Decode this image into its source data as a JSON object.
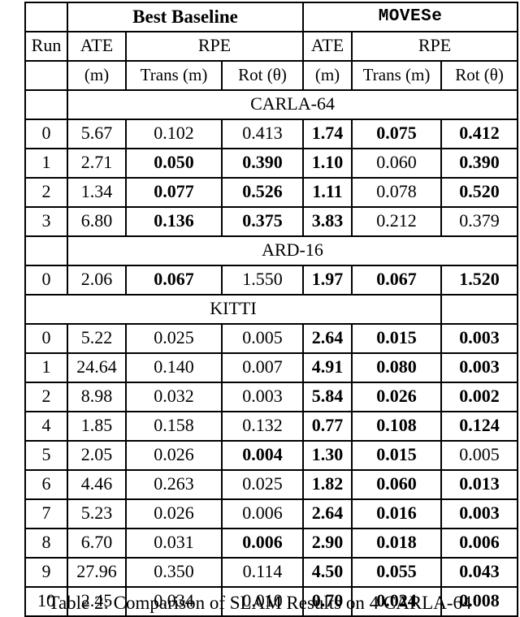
{
  "table": {
    "headers": {
      "group_blank": "",
      "group_baseline": "Best Baseline",
      "group_ours": "MOVESe",
      "run": "Run",
      "ate1": "ATE",
      "rpe1": "RPE",
      "ate2": "ATE",
      "rpe2": "RPE",
      "units_blank": "",
      "ate1_units": "(m)",
      "trans1": "Trans (m)",
      "rot1": "Rot (θ)",
      "ate2_units": "(m)",
      "trans2": "Trans (m)",
      "rot2": "Rot (θ)"
    },
    "sections": [
      {
        "name": "CARLA-64",
        "rows": [
          {
            "run": "0",
            "b_ate": "5.67",
            "b_ate_bold": false,
            "b_trans": "0.102",
            "b_trans_bold": false,
            "b_rot": "0.413",
            "b_rot_bold": false,
            "m_ate": "1.74",
            "m_ate_bold": true,
            "m_trans": "0.075",
            "m_trans_bold": true,
            "m_rot": "0.412",
            "m_rot_bold": true
          },
          {
            "run": "1",
            "b_ate": "2.71",
            "b_ate_bold": false,
            "b_trans": "0.050",
            "b_trans_bold": true,
            "b_rot": "0.390",
            "b_rot_bold": true,
            "m_ate": "1.10",
            "m_ate_bold": true,
            "m_trans": "0.060",
            "m_trans_bold": false,
            "m_rot": "0.390",
            "m_rot_bold": true
          },
          {
            "run": "2",
            "b_ate": "1.34",
            "b_ate_bold": false,
            "b_trans": "0.077",
            "b_trans_bold": true,
            "b_rot": "0.526",
            "b_rot_bold": true,
            "m_ate": "1.11",
            "m_ate_bold": true,
            "m_trans": "0.078",
            "m_trans_bold": false,
            "m_rot": "0.520",
            "m_rot_bold": true
          },
          {
            "run": "3",
            "b_ate": "6.80",
            "b_ate_bold": false,
            "b_trans": "0.136",
            "b_trans_bold": true,
            "b_rot": "0.375",
            "b_rot_bold": true,
            "m_ate": "3.83",
            "m_ate_bold": true,
            "m_trans": "0.212",
            "m_trans_bold": false,
            "m_rot": "0.379",
            "m_rot_bold": false
          }
        ]
      },
      {
        "name": "ARD-16",
        "rows": [
          {
            "run": "0",
            "b_ate": "2.06",
            "b_ate_bold": false,
            "b_trans": "0.067",
            "b_trans_bold": true,
            "b_rot": "1.550",
            "b_rot_bold": false,
            "m_ate": "1.97",
            "m_ate_bold": true,
            "m_trans": "0.067",
            "m_trans_bold": true,
            "m_rot": "1.520",
            "m_rot_bold": true
          }
        ]
      },
      {
        "name": "KITTI",
        "rows": [
          {
            "run": "0",
            "b_ate": "5.22",
            "b_ate_bold": false,
            "b_trans": "0.025",
            "b_trans_bold": false,
            "b_rot": "0.005",
            "b_rot_bold": false,
            "m_ate": "2.64",
            "m_ate_bold": true,
            "m_trans": "0.015",
            "m_trans_bold": true,
            "m_rot": "0.003",
            "m_rot_bold": true
          },
          {
            "run": "1",
            "b_ate": "24.64",
            "b_ate_bold": false,
            "b_trans": "0.140",
            "b_trans_bold": false,
            "b_rot": "0.007",
            "b_rot_bold": false,
            "m_ate": "4.91",
            "m_ate_bold": true,
            "m_trans": "0.080",
            "m_trans_bold": true,
            "m_rot": "0.003",
            "m_rot_bold": true
          },
          {
            "run": "2",
            "b_ate": "8.98",
            "b_ate_bold": false,
            "b_trans": "0.032",
            "b_trans_bold": false,
            "b_rot": "0.003",
            "b_rot_bold": false,
            "m_ate": "5.84",
            "m_ate_bold": true,
            "m_trans": "0.026",
            "m_trans_bold": true,
            "m_rot": "0.002",
            "m_rot_bold": true
          },
          {
            "run": "4",
            "b_ate": "1.85",
            "b_ate_bold": false,
            "b_trans": "0.158",
            "b_trans_bold": false,
            "b_rot": "0.132",
            "b_rot_bold": false,
            "m_ate": "0.77",
            "m_ate_bold": true,
            "m_trans": "0.108",
            "m_trans_bold": true,
            "m_rot": "0.124",
            "m_rot_bold": true
          },
          {
            "run": "5",
            "b_ate": "2.05",
            "b_ate_bold": false,
            "b_trans": "0.026",
            "b_trans_bold": false,
            "b_rot": "0.004",
            "b_rot_bold": true,
            "m_ate": "1.30",
            "m_ate_bold": true,
            "m_trans": "0.015",
            "m_trans_bold": true,
            "m_rot": "0.005",
            "m_rot_bold": false
          },
          {
            "run": "6",
            "b_ate": "4.46",
            "b_ate_bold": false,
            "b_trans": "0.263",
            "b_trans_bold": false,
            "b_rot": "0.025",
            "b_rot_bold": false,
            "m_ate": "1.82",
            "m_ate_bold": true,
            "m_trans": "0.060",
            "m_trans_bold": true,
            "m_rot": "0.013",
            "m_rot_bold": true
          },
          {
            "run": "7",
            "b_ate": "5.23",
            "b_ate_bold": false,
            "b_trans": "0.026",
            "b_trans_bold": false,
            "b_rot": "0.006",
            "b_rot_bold": false,
            "m_ate": "2.64",
            "m_ate_bold": true,
            "m_trans": "0.016",
            "m_trans_bold": true,
            "m_rot": "0.003",
            "m_rot_bold": true
          },
          {
            "run": "8",
            "b_ate": "6.70",
            "b_ate_bold": false,
            "b_trans": "0.031",
            "b_trans_bold": false,
            "b_rot": "0.006",
            "b_rot_bold": true,
            "m_ate": "2.90",
            "m_ate_bold": true,
            "m_trans": "0.018",
            "m_trans_bold": true,
            "m_rot": "0.006",
            "m_rot_bold": true
          },
          {
            "run": "9",
            "b_ate": "27.96",
            "b_ate_bold": false,
            "b_trans": "0.350",
            "b_trans_bold": false,
            "b_rot": "0.114",
            "b_rot_bold": false,
            "m_ate": "4.50",
            "m_ate_bold": true,
            "m_trans": "0.055",
            "m_trans_bold": true,
            "m_rot": "0.043",
            "m_rot_bold": true
          },
          {
            "run": "10",
            "b_ate": "2.45",
            "b_ate_bold": false,
            "b_trans": "0.034",
            "b_trans_bold": false,
            "b_rot": "0.010",
            "b_rot_bold": false,
            "m_ate": "0.70",
            "m_ate_bold": true,
            "m_trans": "0.024",
            "m_trans_bold": true,
            "m_rot": "0.008",
            "m_rot_bold": true
          }
        ]
      }
    ]
  },
  "caption": "Table 2: Comparison of SLAM Results on 4 CARLA-64"
}
